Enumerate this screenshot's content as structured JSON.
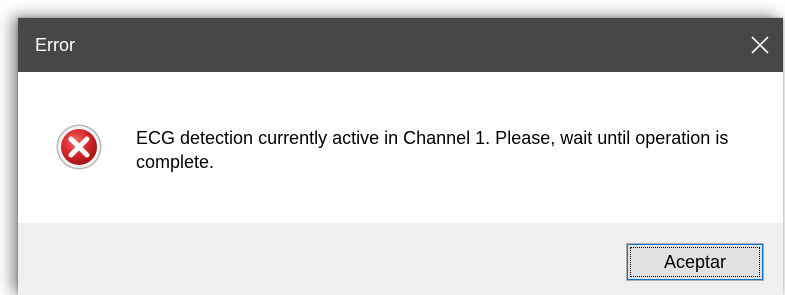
{
  "window": {
    "title": "Error",
    "close_icon": "close-icon"
  },
  "dialog": {
    "icon": "error-icon",
    "message": "ECG detection currently active in Channel 1. Please, wait until operation is complete."
  },
  "buttons": {
    "ok_label": "Aceptar"
  },
  "colors": {
    "titlebar": "#474747",
    "footer": "#f0f0f0",
    "error_red": "#d8282a",
    "button_focus": "#0078d7"
  }
}
